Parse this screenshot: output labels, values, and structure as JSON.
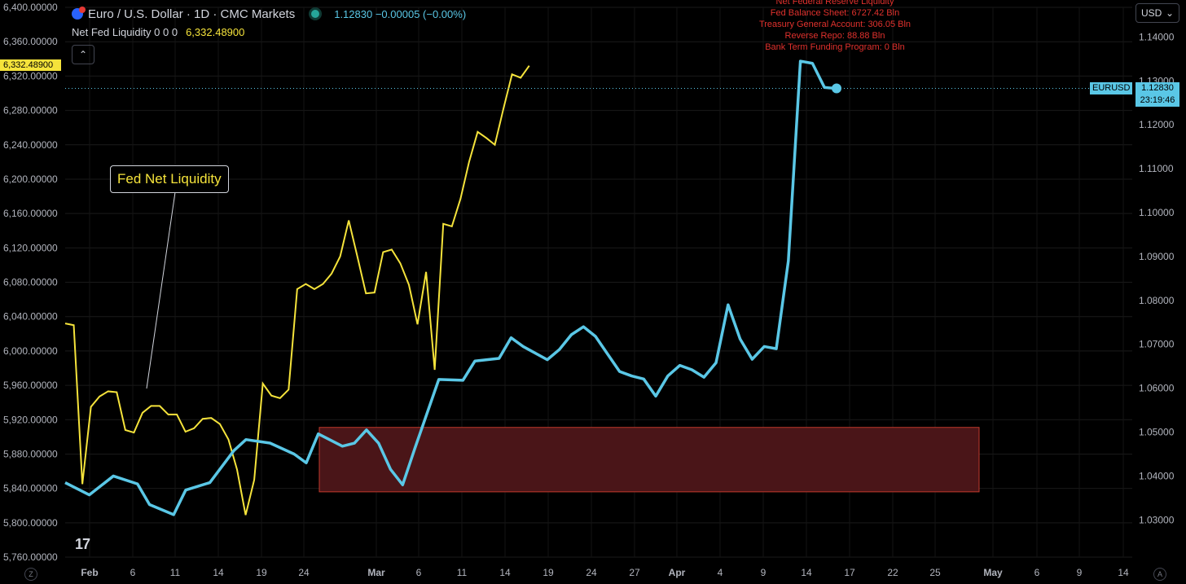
{
  "header": {
    "symbol_title": "Euro / U.S. Dollar · 1D · CMC Markets",
    "price": "1.12830",
    "change": "−0.00005 (−0.00%)"
  },
  "indicator": {
    "name": "Net Fed Liquidity 0 0 0",
    "value": "6,332.48900"
  },
  "currency_button": {
    "label": "USD"
  },
  "collapse_icon": "chevron-up-icon",
  "callout": {
    "text": "Fed Net Liquidity"
  },
  "notes": [
    "Net Federal Reserve Liquidity",
    "Fed Balance Sheet: 6727.42 Bln",
    "Treasury General Account: 306.05 Bln",
    "Reverse Repo: 88.88 Bln",
    "Bank Term Funding Program: 0 Bln"
  ],
  "left_price_tag": "6,332.48900",
  "right_symbol_tag": "EURUSD",
  "right_price_tag": "1.12830",
  "right_countdown": "23:19:46",
  "corner_left": "Z",
  "corner_right": "A",
  "colors": {
    "liquidity": "#f5e33b",
    "eurusd": "#5ac7e6",
    "zone_fill": "#4a1518",
    "zone_stroke": "#c0392b",
    "notes": "#e0312d"
  },
  "chart_data": {
    "type": "line",
    "left_axis": {
      "ylim": [
        5760,
        6400
      ],
      "tick_labels": [
        "6,400.00000",
        "6,360.00000",
        "6,320.00000",
        "6,280.00000",
        "6,240.00000",
        "6,200.00000",
        "6,160.00000",
        "6,120.00000",
        "6,080.00000",
        "6,040.00000",
        "6,000.00000",
        "5,960.00000",
        "5,920.00000",
        "5,880.00000",
        "5,840.00000",
        "5,800.00000",
        "5,760.00000"
      ],
      "ticks": [
        6400,
        6360,
        6320,
        6280,
        6240,
        6200,
        6160,
        6120,
        6080,
        6040,
        6000,
        5960,
        5920,
        5880,
        5840,
        5800,
        5760
      ]
    },
    "right_axis": {
      "ylim": [
        1.027,
        1.1455
      ],
      "tick_labels": [
        "1.14000",
        "1.13000",
        "1.12000",
        "1.11000",
        "1.10000",
        "1.09000",
        "1.08000",
        "1.07000",
        "1.06000",
        "1.05000",
        "1.04000",
        "1.03000"
      ],
      "ticks": [
        1.14,
        1.13,
        1.12,
        1.11,
        1.1,
        1.09,
        1.08,
        1.07,
        1.06,
        1.05,
        1.04,
        1.03
      ]
    },
    "x_axis": {
      "labels": [
        "Feb",
        "6",
        "11",
        "14",
        "19",
        "24",
        "Mar",
        "6",
        "11",
        "14",
        "19",
        "24",
        "27",
        "Apr",
        "4",
        "9",
        "14",
        "17",
        "22",
        "25",
        "May",
        "6",
        "9",
        "14"
      ],
      "bold": [
        "Feb",
        "Mar",
        "Apr",
        "May"
      ]
    },
    "series": [
      {
        "axis": "left",
        "points": [
          [
            0,
            6032
          ],
          [
            1,
            6030
          ],
          [
            2,
            5845
          ],
          [
            3,
            5935
          ],
          [
            4,
            5947
          ],
          [
            5,
            5953
          ],
          [
            6,
            5952
          ],
          [
            7,
            5908
          ],
          [
            8,
            5905
          ],
          [
            9,
            5928
          ],
          [
            10,
            5936
          ],
          [
            11,
            5936
          ],
          [
            12,
            5926
          ],
          [
            13,
            5926
          ],
          [
            14,
            5906
          ],
          [
            15,
            5910
          ],
          [
            16,
            5921
          ],
          [
            17,
            5922
          ],
          [
            18,
            5915
          ],
          [
            19,
            5897
          ],
          [
            20,
            5862
          ],
          [
            21,
            5809
          ],
          [
            22,
            5850
          ],
          [
            23,
            5962
          ],
          [
            24,
            5948
          ],
          [
            25,
            5945
          ],
          [
            26,
            5955
          ],
          [
            27,
            6072
          ],
          [
            28,
            6078
          ],
          [
            29,
            6072
          ],
          [
            30,
            6078
          ],
          [
            31,
            6090
          ],
          [
            32,
            6110
          ],
          [
            33,
            6152
          ],
          [
            34,
            6110
          ],
          [
            35,
            6067
          ],
          [
            36,
            6068
          ],
          [
            37,
            6115
          ],
          [
            38,
            6118
          ],
          [
            39,
            6102
          ],
          [
            40,
            6077
          ],
          [
            41,
            6031
          ],
          [
            42,
            6092
          ],
          [
            43,
            5978
          ],
          [
            44,
            6148
          ],
          [
            45,
            6145
          ],
          [
            46,
            6177
          ],
          [
            47,
            6220
          ],
          [
            48,
            6255
          ],
          [
            49,
            6248
          ],
          [
            50,
            6240
          ],
          [
            51,
            6282
          ],
          [
            52,
            6322
          ],
          [
            53,
            6318
          ],
          [
            54,
            6332
          ]
        ]
      },
      {
        "axis": "right",
        "points": [
          [
            0,
            1.0385
          ],
          [
            2,
            1.0357
          ],
          [
            4,
            1.04
          ],
          [
            6,
            1.0382
          ],
          [
            7,
            1.0335
          ],
          [
            9,
            1.0312
          ],
          [
            10,
            1.0368
          ],
          [
            12,
            1.0385
          ],
          [
            14,
            1.0458
          ],
          [
            15,
            1.0483
          ],
          [
            17,
            1.0475
          ],
          [
            19,
            1.045
          ],
          [
            20,
            1.043
          ],
          [
            21,
            1.0496
          ],
          [
            23,
            1.0468
          ],
          [
            24,
            1.0475
          ],
          [
            25,
            1.0505
          ],
          [
            26,
            1.0475
          ],
          [
            27,
            1.0415
          ],
          [
            28,
            1.038
          ],
          [
            29,
            1.0462
          ],
          [
            31,
            1.062
          ],
          [
            33,
            1.0618
          ],
          [
            34,
            1.0662
          ],
          [
            36,
            1.0668
          ],
          [
            37,
            1.0715
          ],
          [
            38,
            1.0695
          ],
          [
            40,
            1.0665
          ],
          [
            41,
            1.0688
          ],
          [
            42,
            1.0722
          ],
          [
            43,
            1.074
          ],
          [
            44,
            1.0718
          ],
          [
            45,
            1.0678
          ],
          [
            46,
            1.0638
          ],
          [
            47,
            1.0628
          ],
          [
            48,
            1.0621
          ],
          [
            49,
            1.0582
          ],
          [
            50,
            1.0628
          ],
          [
            51,
            1.0652
          ],
          [
            52,
            1.0642
          ],
          [
            53,
            1.0625
          ],
          [
            54,
            1.0658
          ],
          [
            55,
            1.079
          ],
          [
            56,
            1.0712
          ],
          [
            57,
            1.0666
          ],
          [
            58,
            1.0695
          ],
          [
            59,
            1.069
          ],
          [
            60,
            1.089
          ],
          [
            61,
            1.1345
          ],
          [
            62,
            1.134
          ],
          [
            63,
            1.1285
          ],
          [
            64,
            1.1283
          ]
        ]
      }
    ],
    "zone": {
      "x_from": 26,
      "x_to": 69,
      "y_top": 5911,
      "y_bottom": 5836
    }
  }
}
